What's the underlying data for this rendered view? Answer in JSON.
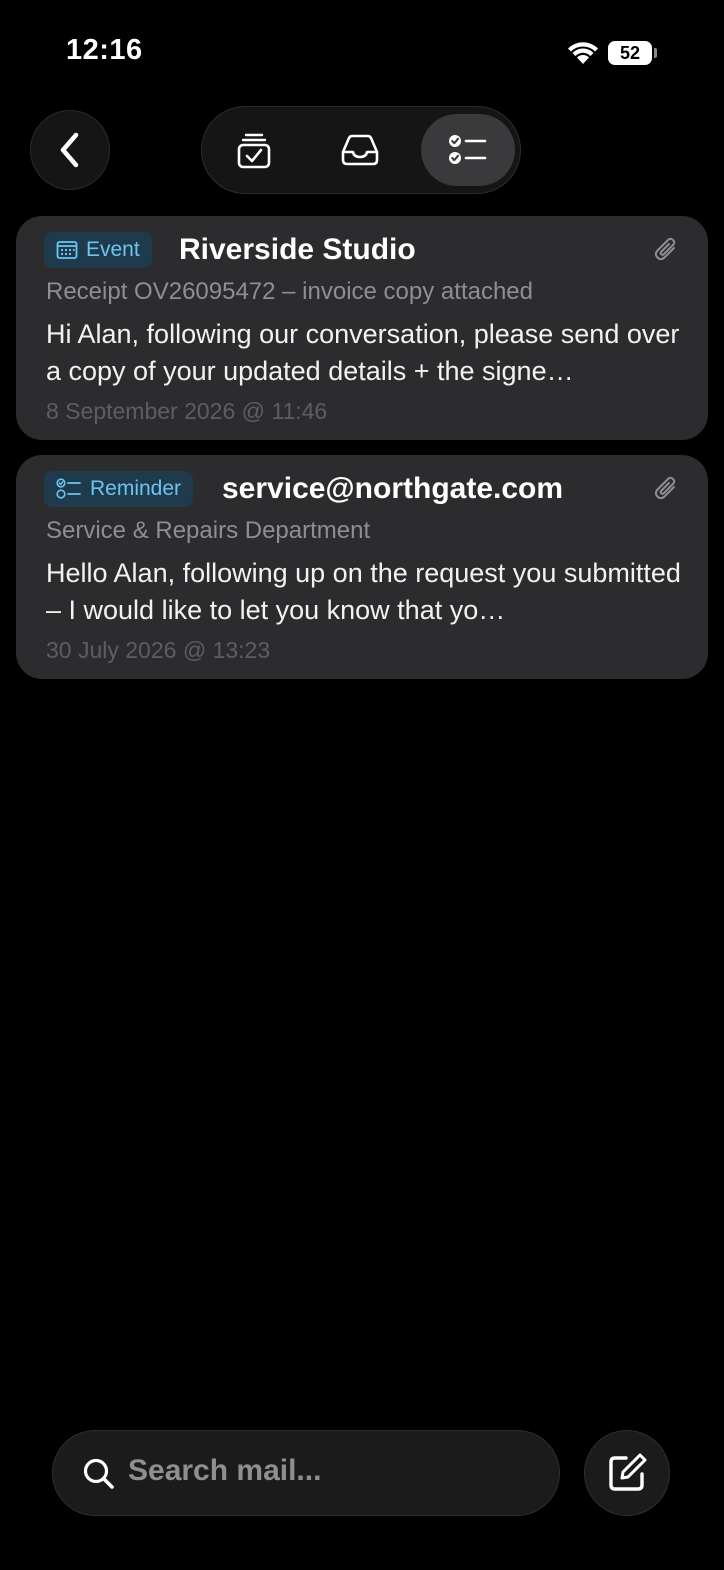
{
  "status_bar": {
    "time": "12:16",
    "battery": "52",
    "icons": [
      "wifi-icon",
      "battery-icon"
    ]
  },
  "top_bar": {
    "back_icon": "chevron-left-icon",
    "segments": [
      {
        "icon": "tray-check-icon",
        "active": false
      },
      {
        "icon": "inbox-icon",
        "active": false
      },
      {
        "icon": "checklist-icon",
        "active": true
      }
    ]
  },
  "messages": [
    {
      "tag": {
        "label": "Event",
        "icon": "calendar-icon"
      },
      "sender": "Riverside Studio",
      "subject": "Receipt OV26095472 – invoice copy attached",
      "preview": "Hi Alan, following our conversation, please send over a copy of your updated details + the signe…",
      "date": "8 September 2026 @ 11:46",
      "has_attachment": true
    },
    {
      "tag": {
        "label": "Reminder",
        "icon": "checklist-icon"
      },
      "sender": "service@northgate.com",
      "subject": "Service & Repairs Department",
      "preview": "Hello Alan, following up on the request you submitted – I would like to let you know that yo…",
      "date": "30 July 2026 @ 13:23",
      "has_attachment": true
    }
  ],
  "bottom_bar": {
    "search_placeholder": "Search mail...",
    "search_icon": "search-icon",
    "compose_icon": "compose-icon"
  },
  "colors": {
    "background": "#000000",
    "card": "#2c2c2e",
    "tag_bg": "#1f3a4d",
    "tag_text": "#6cc5f0",
    "secondary_text": "#8e8e93",
    "date_text": "#5e5e62"
  }
}
